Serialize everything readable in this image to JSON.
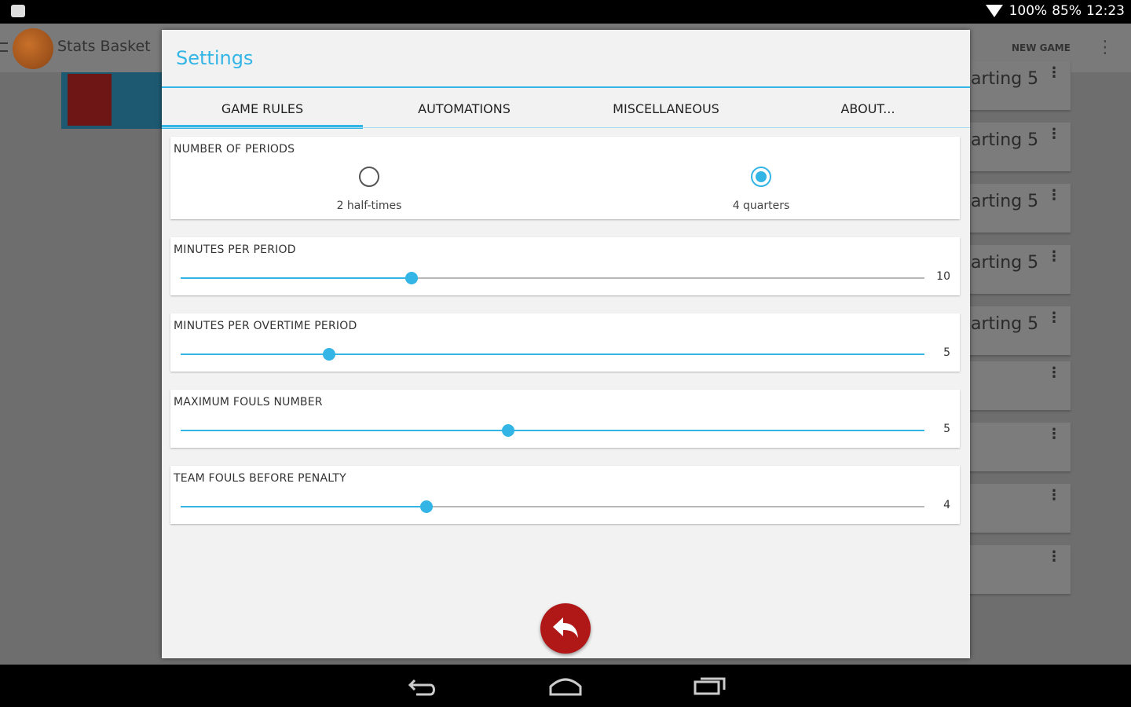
{
  "statusbar": {
    "battery": "100%",
    "signal": "85%",
    "time": "12:23"
  },
  "app": {
    "title": "Stats Basket",
    "new_game": "NEW GAME",
    "bg_cards": [
      "arting 5",
      "arting 5",
      "arting 5",
      "arting 5",
      "arting 5",
      "",
      "",
      "",
      ""
    ]
  },
  "dialog": {
    "title": "Settings",
    "tabs": [
      "GAME RULES",
      "AUTOMATIONS",
      "MISCELLANEOUS",
      "ABOUT..."
    ],
    "active_tab": 0,
    "periods": {
      "label": "NUMBER OF PERIODS",
      "options": [
        "2 half-times",
        "4 quarters"
      ],
      "selected": 1
    },
    "sliders": [
      {
        "label": "MINUTES PER PERIOD",
        "value": "10",
        "fraction": 0.31,
        "fill_style": "partial"
      },
      {
        "label": "MINUTES PER OVERTIME PERIOD",
        "value": "5",
        "fraction": 0.2
      },
      {
        "label": "MAXIMUM FOULS NUMBER",
        "value": "5",
        "fraction": 0.44
      },
      {
        "label": "TEAM FOULS BEFORE PENALTY",
        "value": "4",
        "fraction": 0.33,
        "fill_style": "partial"
      }
    ]
  },
  "colors": {
    "accent": "#33b5e5",
    "fab": "#b01717"
  },
  "icons": {
    "fab": "reply-arrow-icon",
    "nav": [
      "back-icon",
      "home-icon",
      "recents-icon"
    ]
  }
}
